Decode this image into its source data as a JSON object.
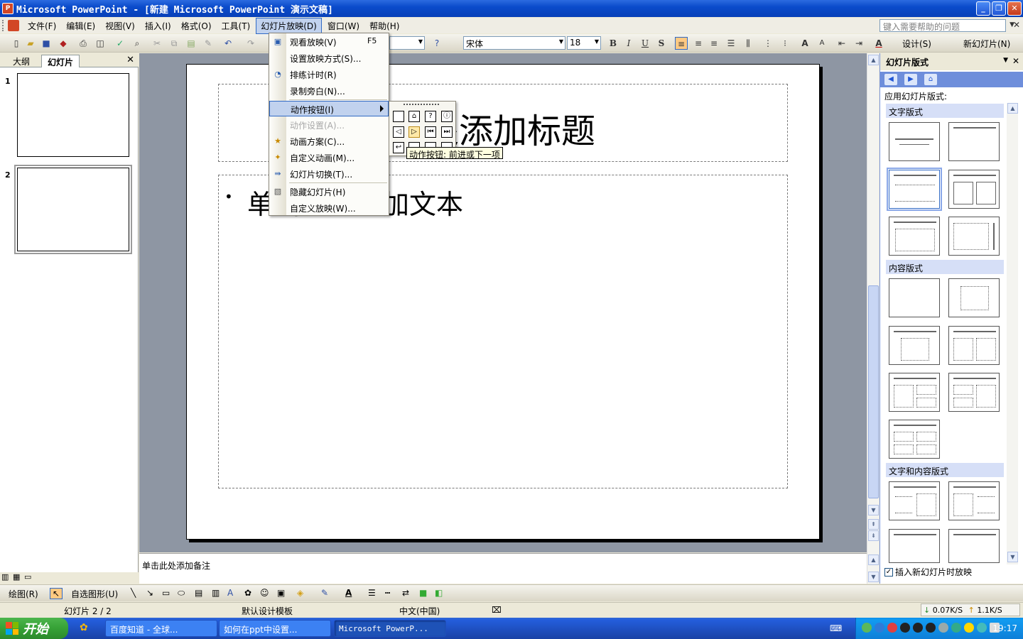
{
  "window": {
    "title": "Microsoft PowerPoint - [新建 Microsoft PowerPoint 演示文稿]"
  },
  "menu": {
    "items": [
      "文件(F)",
      "编辑(E)",
      "视图(V)",
      "插入(I)",
      "格式(O)",
      "工具(T)",
      "幻灯片放映(D)",
      "窗口(W)",
      "帮助(H)"
    ],
    "help_placeholder": "键入需要帮助的问题"
  },
  "toolbar": {
    "font_name": "宋体",
    "font_size": "18",
    "bold": "B",
    "italic": "I",
    "underline": "U",
    "shadow": "S",
    "design_label": "设计(S)",
    "new_slide_label": "新幻灯片(N)"
  },
  "left_panel": {
    "tabs": [
      "大纲",
      "幻灯片"
    ],
    "thumbs": [
      "1",
      "2"
    ]
  },
  "slide": {
    "title_placeholder": "单击此处添加标题",
    "body_placeholder": "单击此处添加文本",
    "bullet": "•"
  },
  "dropdown": {
    "items": [
      {
        "label": "观看放映(V)",
        "key": "F5",
        "icon": "slideshow-icon"
      },
      {
        "label": "设置放映方式(S)...",
        "key": "",
        "icon": ""
      },
      {
        "label": "排练计时(R)",
        "key": "",
        "icon": "timing-icon"
      },
      {
        "label": "录制旁白(N)...",
        "key": "",
        "icon": ""
      },
      {
        "label": "动作按钮(I)",
        "key": "",
        "icon": ""
      },
      {
        "label": "动作设置(A)...",
        "key": "",
        "icon": ""
      },
      {
        "label": "动画方案(C)...",
        "key": "",
        "icon": "animation-scheme-icon"
      },
      {
        "label": "自定义动画(M)...",
        "key": "",
        "icon": "custom-animation-icon"
      },
      {
        "label": "幻灯片切换(T)...",
        "key": "",
        "icon": "transition-icon"
      },
      {
        "label": "隐藏幻灯片(H)",
        "key": "",
        "icon": "hide-slide-icon"
      },
      {
        "label": "自定义放映(W)...",
        "key": "",
        "icon": ""
      }
    ]
  },
  "submenu": {
    "tooltip": "动作按钮: 前进或下一项"
  },
  "notes": {
    "placeholder": "单击此处添加备注"
  },
  "task_pane": {
    "title": "幻灯片版式",
    "apply_label": "应用幻灯片版式:",
    "sections": [
      "文字版式",
      "内容版式",
      "文字和内容版式"
    ],
    "footer_label": "插入新幻灯片时放映"
  },
  "drawbar": {
    "draw_label": "绘图(R)",
    "autoshape_label": "自选图形(U)"
  },
  "status": {
    "slide_pos": "幻灯片 2 / 2",
    "template": "默认设计模板",
    "language": "中文(中国)"
  },
  "network": {
    "down": "0.07K/S",
    "up": "1.1K/S"
  },
  "taskbar": {
    "start_label": "开始",
    "tasks": [
      "百度知道 - 全球...",
      "如何在ppt中设置...",
      "Microsoft PowerP..."
    ],
    "clock": "19:17"
  },
  "colors": {
    "titlebar": "#0A4BCB",
    "menu_highlight": "#C1D2EE",
    "slide_bg": "#8E96A3",
    "taskbar": "#245EDC",
    "start": "#36A136"
  }
}
